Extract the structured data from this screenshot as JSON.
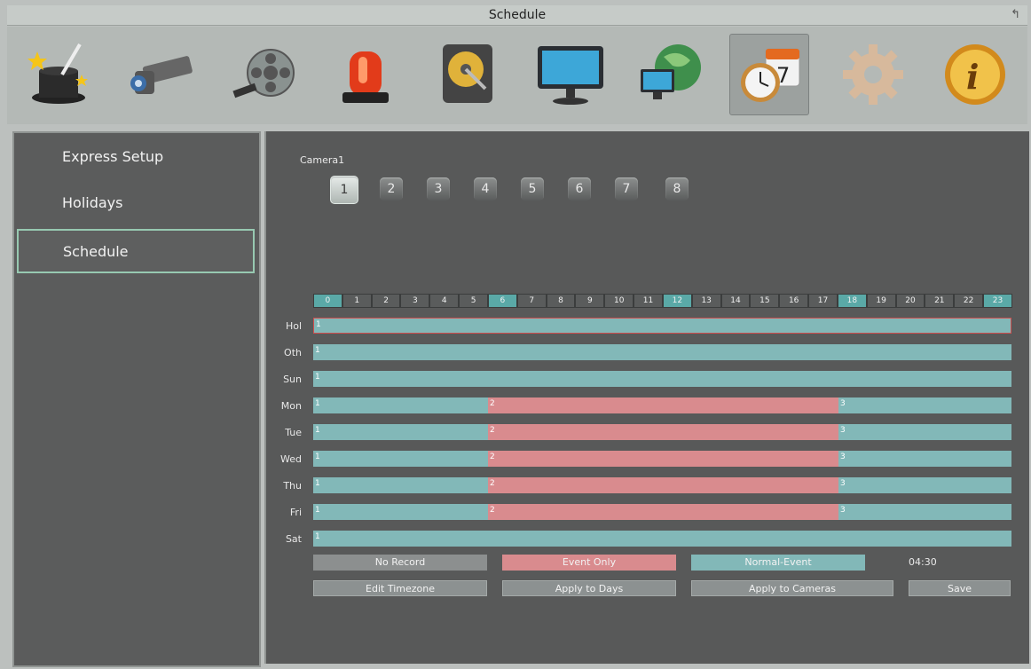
{
  "window": {
    "title": "Schedule"
  },
  "toolbar": {
    "icons": [
      "wizard-icon",
      "camera-icon",
      "film-reel-icon",
      "alarm-light-icon",
      "hard-drive-icon",
      "monitor-icon",
      "network-globe-icon",
      "schedule-clock-calendar-icon",
      "gear-icon",
      "info-icon"
    ],
    "selected": "schedule-clock-calendar-icon"
  },
  "sidebar": {
    "items": [
      {
        "label": "Express Setup"
      },
      {
        "label": "Holidays"
      },
      {
        "label": "Schedule"
      }
    ],
    "selected": "Schedule"
  },
  "camera": {
    "label": "Camera1",
    "buttons": [
      "1",
      "2",
      "3",
      "4",
      "5",
      "6",
      "7",
      "8"
    ],
    "selected": "1"
  },
  "hours": [
    "0",
    "1",
    "2",
    "3",
    "4",
    "5",
    "6",
    "7",
    "8",
    "9",
    "10",
    "11",
    "12",
    "13",
    "14",
    "15",
    "16",
    "17",
    "18",
    "19",
    "20",
    "21",
    "22",
    "23"
  ],
  "highlighted_hours": [
    "0",
    "6",
    "12",
    "18",
    "23"
  ],
  "days": [
    {
      "label": "Hol"
    },
    {
      "label": "Oth"
    },
    {
      "label": "Sun"
    },
    {
      "label": "Mon"
    },
    {
      "label": "Tue"
    },
    {
      "label": "Wed"
    },
    {
      "label": "Thu"
    },
    {
      "label": "Fri"
    },
    {
      "label": "Sat"
    }
  ],
  "segment_labels": {
    "first": "1",
    "second": "2",
    "third": "3"
  },
  "legend": {
    "no_record": "No Record",
    "event_only": "Event Only",
    "normal_event": "Normal-Event",
    "time": "04:30"
  },
  "buttons": {
    "edit_timezone": "Edit Timezone",
    "apply_days": "Apply to Days",
    "apply_cameras": "Apply to Cameras",
    "save": "Save"
  },
  "colors": {
    "normal_event": "#82b8b8",
    "event_only": "#d98b8e",
    "no_record": "#8c8f8f",
    "highlight": "#5aa9a7"
  }
}
